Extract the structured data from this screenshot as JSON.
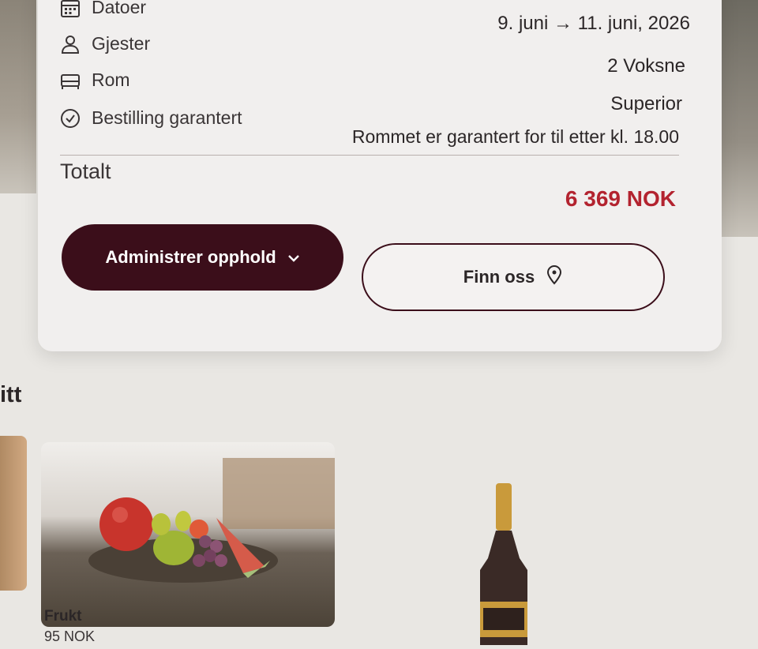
{
  "booking": {
    "rows": [
      {
        "label": "Datoer",
        "value": "9. juni → 11. juni, 2026",
        "icon": "calendar-icon"
      },
      {
        "label": "Gjester",
        "value": "2 Voksne",
        "icon": "person-icon"
      },
      {
        "label": "Rom",
        "value": "Superior",
        "icon": "bed-icon"
      },
      {
        "label": "Bestilling garantert",
        "value": "Rommet er garantert for til etter kl. 18.00",
        "icon": "check-circle-icon"
      }
    ],
    "total_label": "Totalt",
    "total_value": "6 369 NOK",
    "manage_button": "Administrer opphold",
    "find_button": "Finn oss"
  },
  "section": {
    "title_fragment": "itt"
  },
  "products": [
    {
      "name": "Frukt",
      "price": "95 NOK"
    }
  ],
  "colors": {
    "accent": "#3b0e1a",
    "price": "#b3232f"
  }
}
